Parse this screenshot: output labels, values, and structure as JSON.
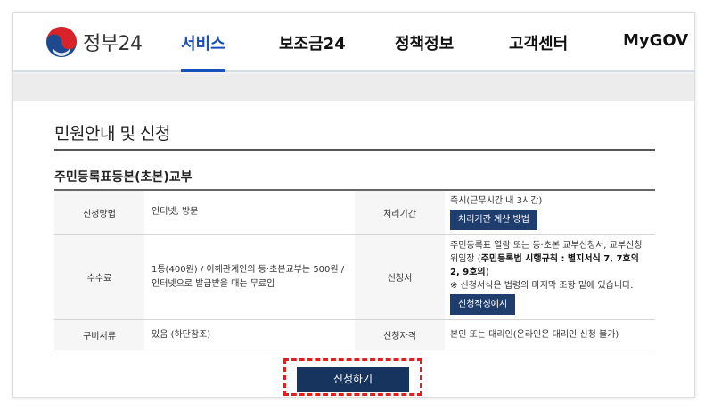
{
  "header": {
    "logo_text": "정부24",
    "nav": [
      {
        "label": "서비스",
        "active": true
      },
      {
        "label": "보조금24",
        "active": false
      },
      {
        "label": "정책정보",
        "active": false
      },
      {
        "label": "고객센터",
        "active": false
      },
      {
        "label": "MyGOV",
        "active": false
      }
    ]
  },
  "main": {
    "page_title": "민원안내 및 신청",
    "section_title": "주민등록표등본(초본)교부",
    "table": {
      "method_label": "신청방법",
      "method_value": "인터넷, 방문",
      "period_label": "처리기간",
      "period_value": "즉시(근무시간 내 3시간)",
      "period_button": "처리기간 계산 방법",
      "fee_label": "수수료",
      "fee_value": "1통(400원) / 이해관계인의 등·초본교부는 500원 / 인터넷으로 발급받을 때는 무료임",
      "form_label": "신청서",
      "form_line1": "주민등록표 열람 또는 등·초본 교부신청서, 교부신청 위임장 (",
      "form_bold": "주민등록법 시행규칙 : 별지서식 7, 7호의2, 9호의",
      "form_line1_end": ")",
      "form_note": "※ 신청서식은 법령의 마지막 조항 밑에 있습니다.",
      "form_button": "신청작성예시",
      "docs_label": "구비서류",
      "docs_value": "있음 (하단참조)",
      "eligibility_label": "신청자격",
      "eligibility_value": "본인 또는 대리인(온라인은 대리인 신청 불가)"
    },
    "apply_button": "신청하기"
  },
  "colors": {
    "accent": "#1a4fbd",
    "button_dark": "#17345e",
    "highlight": "#e0201f"
  }
}
